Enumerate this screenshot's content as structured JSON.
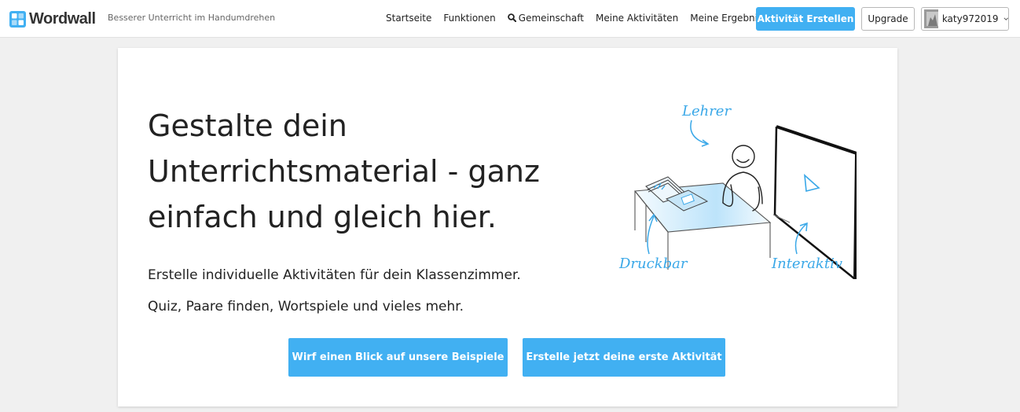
{
  "header": {
    "logo_text": "Wordwall",
    "tagline": "Besserer Unterricht im Handumdrehen",
    "nav": [
      {
        "label": "Startseite",
        "icon": null
      },
      {
        "label": "Funktionen",
        "icon": null
      },
      {
        "label": "Gemeinschaft",
        "icon": "search-icon"
      },
      {
        "label": "Meine Aktivitäten",
        "icon": null
      },
      {
        "label": "Meine Ergebnisse",
        "icon": null
      }
    ],
    "create_button": "Aktivität Erstellen",
    "upgrade_button": "Upgrade",
    "user": {
      "name": "katy972019",
      "avatar_icon": "user-avatar",
      "menu_icon": "chevron-down-icon"
    }
  },
  "hero": {
    "headline": "Gestalte dein Unterrichtsmaterial - ganz einfach und gleich hier.",
    "subline_1": "Erstelle individuelle Aktivitäten für dein Klassenzimmer.",
    "subline_2": "Quiz, Paare finden, Wortspiele und vieles mehr.",
    "cta_examples": "Wirf einen Blick auf unsere Beispiele",
    "cta_first_activity": "Erstelle jetzt deine erste Aktivität",
    "illustration_labels": {
      "teacher": "Lehrer",
      "printable": "Druckbar",
      "interactive": "Interaktiv"
    }
  },
  "colors": {
    "accent": "#41b0f2",
    "page_background": "#f0f0f0",
    "card_background": "#ffffff",
    "text": "#222222"
  }
}
